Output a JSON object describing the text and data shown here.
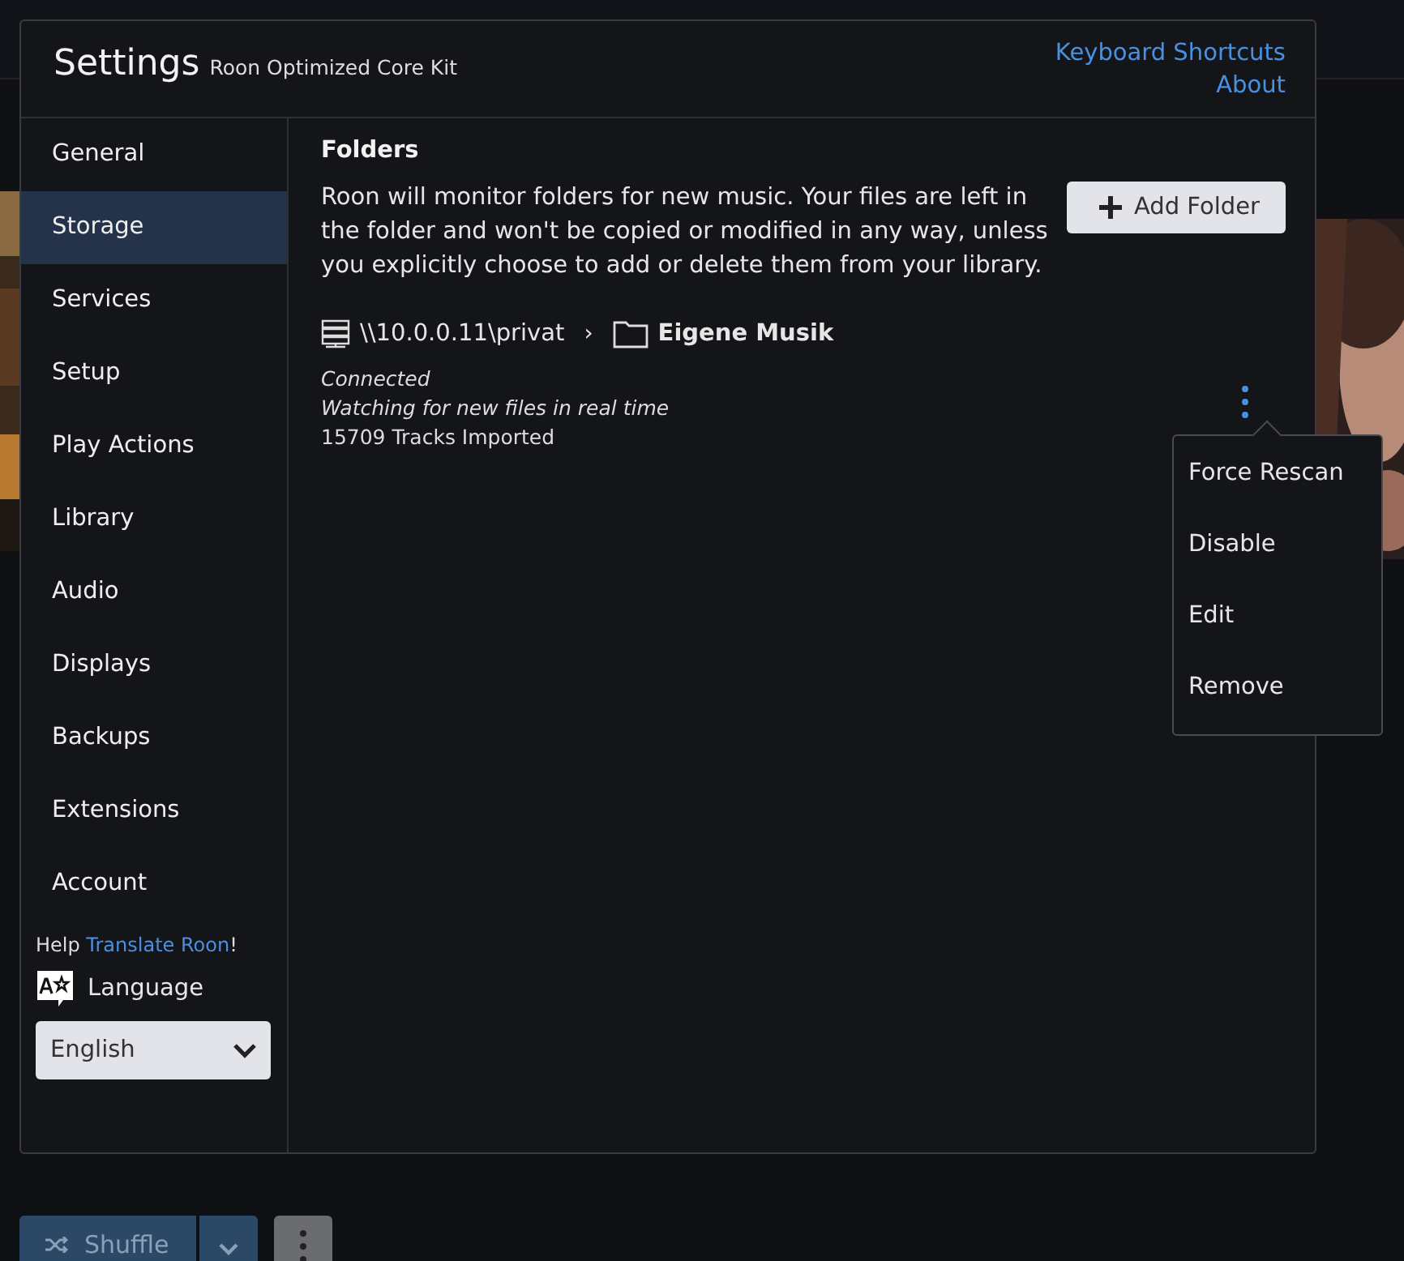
{
  "background": {
    "shuffle_button": "Shuffle"
  },
  "window": {
    "title": "Settings",
    "subtitle": "Roon Optimized Core Kit",
    "links": [
      "Keyboard Shortcuts",
      "About"
    ]
  },
  "sidebar": {
    "items": [
      {
        "label": "General",
        "selected": false
      },
      {
        "label": "Storage",
        "selected": true
      },
      {
        "label": "Services",
        "selected": false
      },
      {
        "label": "Setup",
        "selected": false
      },
      {
        "label": "Play Actions",
        "selected": false
      },
      {
        "label": "Library",
        "selected": false
      },
      {
        "label": "Audio",
        "selected": false
      },
      {
        "label": "Displays",
        "selected": false
      },
      {
        "label": "Backups",
        "selected": false
      },
      {
        "label": "Extensions",
        "selected": false
      },
      {
        "label": "Account",
        "selected": false
      }
    ],
    "help": {
      "before": "Help",
      "link": "Translate Roon",
      "after": "!"
    },
    "language": {
      "label": "Language",
      "value": "English"
    }
  },
  "content": {
    "heading": "Folders",
    "description": "Roon will monitor folders for new music. Your files are left in the folder and won't be copied or modified in any way, unless you explicitly choose to add or delete them from your library.",
    "add_button": "Add Folder",
    "folder": {
      "share": "\\\\10.0.0.11\\privat",
      "separator": "›",
      "name": "Eigene Musik",
      "status": "Connected",
      "watching": "Watching for new files in real time",
      "tracks": "15709 Tracks Imported"
    },
    "menu": [
      "Force Rescan",
      "Disable",
      "Edit",
      "Remove"
    ]
  }
}
